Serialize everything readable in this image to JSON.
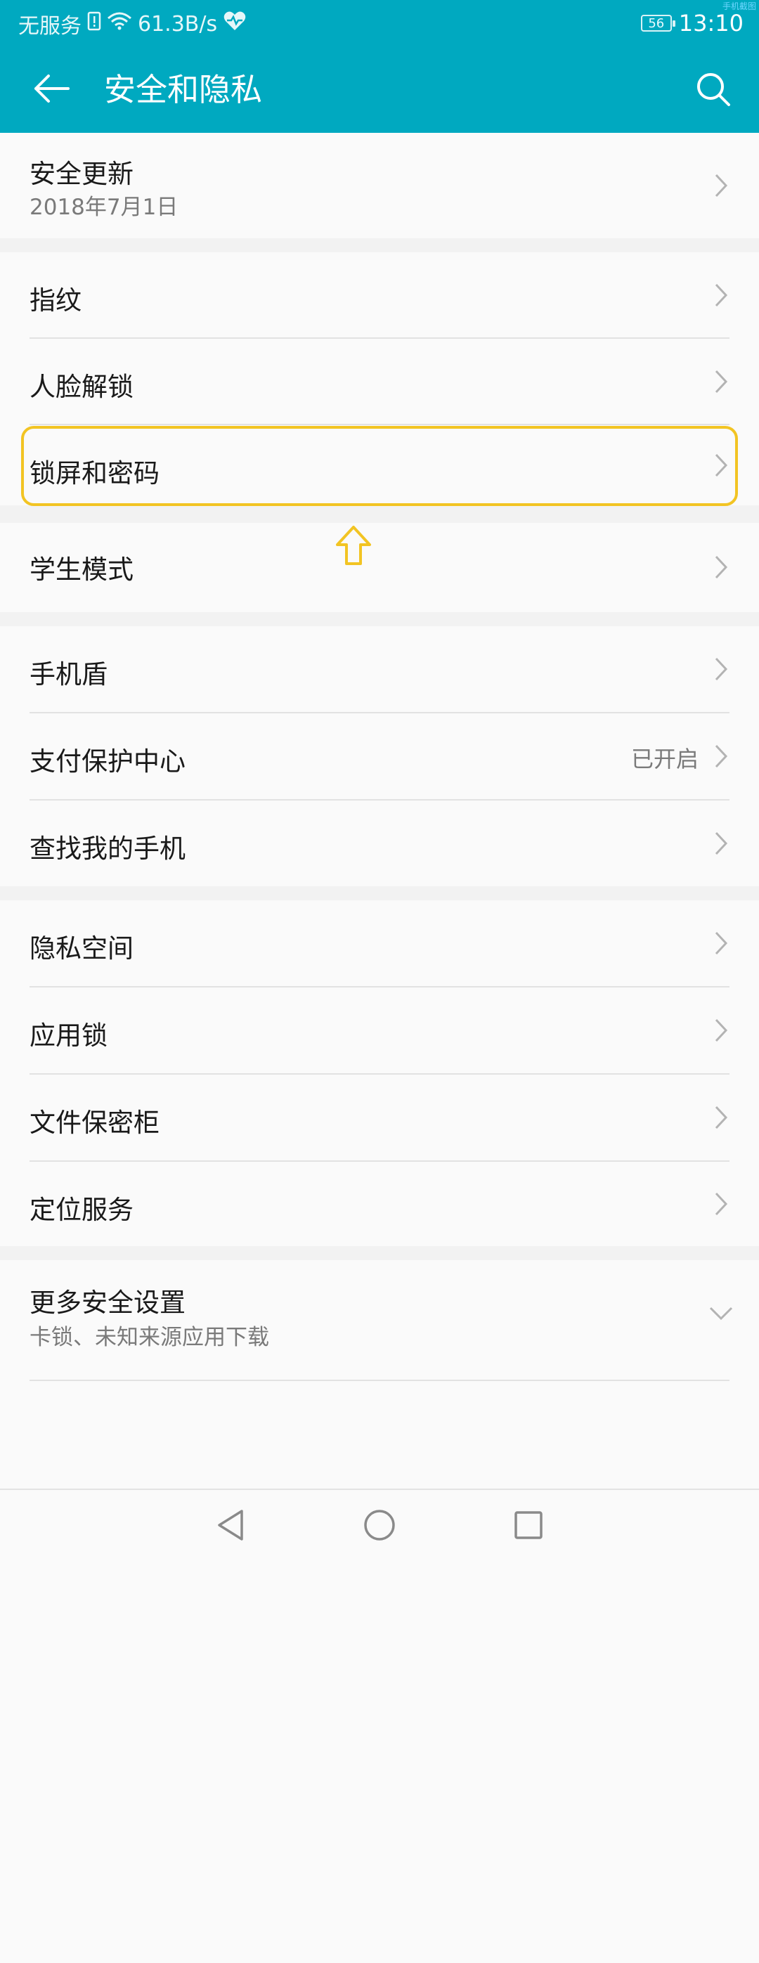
{
  "status_bar": {
    "carrier": "无服务",
    "net_speed": "61.3B/s",
    "battery": "56",
    "time": "13:10",
    "corner_text": "手机截图"
  },
  "app_bar": {
    "title": "安全和隐私"
  },
  "colors": {
    "accent": "#00a9c0",
    "highlight": "#f2c423",
    "background": "#f2f2f2"
  },
  "list": {
    "security_update": {
      "label": "安全更新",
      "sub": "2018年7月1日"
    },
    "fingerprint": {
      "label": "指纹"
    },
    "face_unlock": {
      "label": "人脸解锁"
    },
    "lock_screen": {
      "label": "锁屏和密码"
    },
    "student_mode": {
      "label": "学生模式"
    },
    "phone_shield": {
      "label": "手机盾"
    },
    "payment_protection": {
      "label": "支付保护中心",
      "value": "已开启"
    },
    "find_phone": {
      "label": "查找我的手机"
    },
    "private_space": {
      "label": "隐私空间"
    },
    "app_lock": {
      "label": "应用锁"
    },
    "file_safe": {
      "label": "文件保密柜"
    },
    "location": {
      "label": "定位服务"
    },
    "more_settings": {
      "label": "更多安全设置",
      "sub": "卡锁、未知来源应用下载"
    }
  },
  "icons": {
    "back": "arrow-left",
    "search": "magnifier",
    "chevron": "chevron-right",
    "expand": "chevron-down",
    "nav_back": "triangle-left",
    "nav_home": "circle",
    "nav_recents": "square"
  }
}
